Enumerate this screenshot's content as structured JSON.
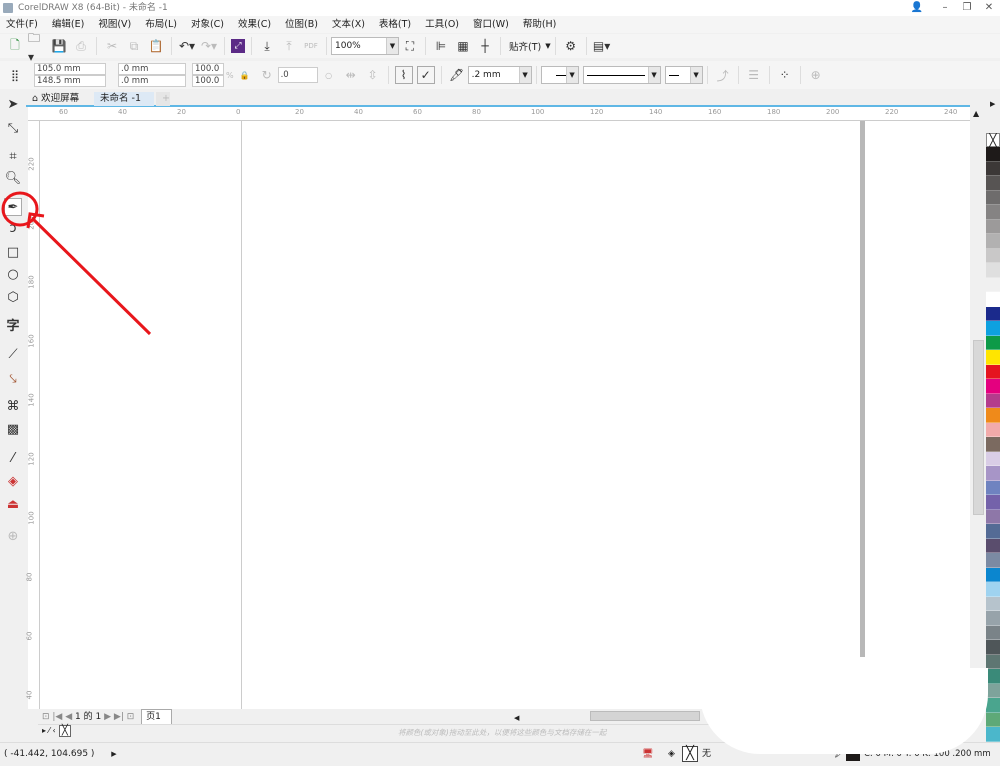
{
  "window": {
    "title": "CorelDRAW X8 (64-Bit) - 未命名 -1"
  },
  "menu": [
    "文件(F)",
    "编辑(E)",
    "视图(V)",
    "布局(L)",
    "对象(C)",
    "效果(C)",
    "位图(B)",
    "文本(X)",
    "表格(T)",
    "工具(O)",
    "窗口(W)",
    "帮助(H)"
  ],
  "toolbar": {
    "zoom": "100%",
    "snap": "贴齐(T)"
  },
  "properties": {
    "x": "105.0 mm",
    "y": "148.5 mm",
    "width": ".0 mm",
    "height": ".0 mm",
    "scale_x": "100.0",
    "scale_y": "100.0",
    "percent": "%",
    "rotation": ".0",
    "outline_width": ".2 mm"
  },
  "tabs": [
    {
      "label": "欢迎屏幕"
    },
    {
      "label": "未命名 -1"
    }
  ],
  "ruler": {
    "h": [
      "60",
      "40",
      "20",
      "0",
      "20",
      "40",
      "60",
      "80",
      "100",
      "120",
      "140",
      "160",
      "180",
      "200",
      "220",
      "240"
    ],
    "v": [
      "220",
      "200",
      "180",
      "160",
      "140",
      "120",
      "100",
      "80",
      "60",
      "40"
    ],
    "unit": "mm"
  },
  "pagenav": {
    "current": "1",
    "of": "的",
    "total": "1",
    "page_tab": "页1"
  },
  "docker": {
    "hint": "将颜色(或对象)拖动至此处，以便将这些颜色与文档存储在一起"
  },
  "status": {
    "coords": "( -41.442, 104.695 )",
    "fill": "无",
    "outline": "C: 0 M: 0 Y: 0 K: 100  .200 mm"
  },
  "palette": [
    "#1e1a19",
    "#3c3837",
    "#575453",
    "#6e6c6c",
    "#858383",
    "#9c9a9a",
    "#b2b1b1",
    "#c9c8c8",
    "#dfdfdf",
    "#f0f0f0",
    "#ffffff",
    "#1b2a8c",
    "#0ea1e0",
    "#0d9a48",
    "#ffe500",
    "#e5141f",
    "#e4007f",
    "#b43c8c",
    "#ef8a1a",
    "#f2aaaa",
    "#7b6a60",
    "#d9cde6",
    "#a795c7",
    "#6f83c0",
    "#7462aa",
    "#8e77a8",
    "#546b95",
    "#5a4d6d",
    "#7b8aa3",
    "#0b86cf",
    "#9fd3f0",
    "#b6c3cc",
    "#97a3aa",
    "#7a8388",
    "#4f5659",
    "#5e7672",
    "#3a8a79",
    "#7ea39b",
    "#4aa58e",
    "#5ea978",
    "#4bb7cb",
    "#3a95a8"
  ],
  "annotation_color": "#e8161b"
}
